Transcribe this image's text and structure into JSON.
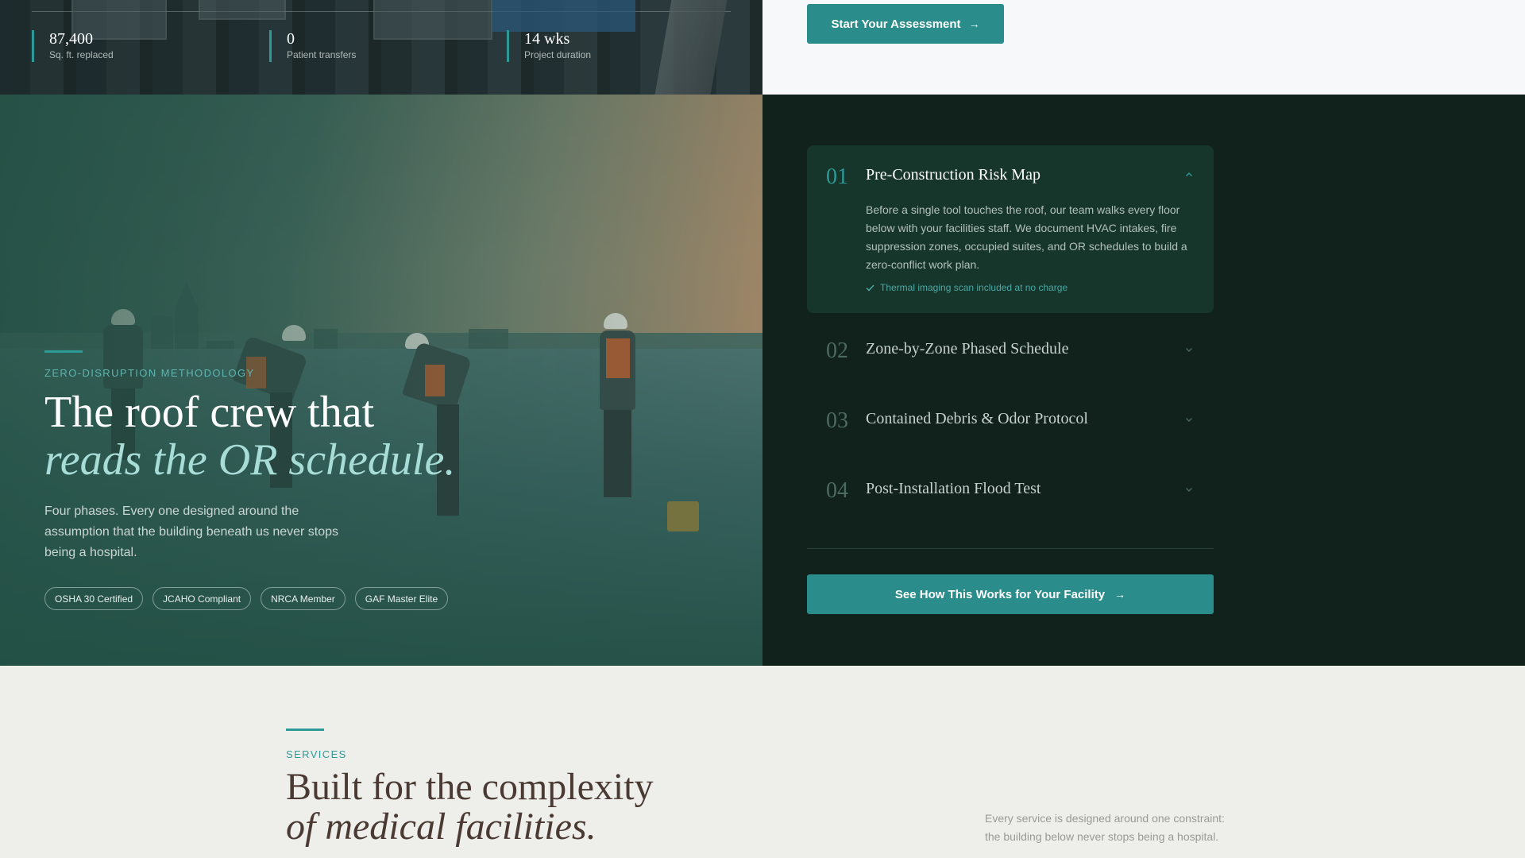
{
  "stats": [
    {
      "value": "87,400",
      "label": "Sq. ft. replaced"
    },
    {
      "value": "0",
      "label": "Patient transfers"
    },
    {
      "value": "14 wks",
      "label": "Project duration"
    }
  ],
  "cta_top": {
    "label": "Start Your Assessment"
  },
  "hero": {
    "eyebrow": "ZERO-DISRUPTION METHODOLOGY",
    "title": "The roof crew that",
    "title_em": "reads the OR schedule.",
    "subtitle": "Four phases. Every one designed around the assumption that the building beneath us never stops being a hospital.",
    "badges": [
      "OSHA 30 Certified",
      "JCAHO Compliant",
      "NRCA Member",
      "GAF Master Elite"
    ]
  },
  "steps": [
    {
      "num": "01",
      "title": "Pre-Construction Risk Map",
      "body": "Before a single tool touches the roof, our team walks every floor below with your facilities staff. We document HVAC intakes, fire suppression zones, occupied suites, and OR schedules to build a zero-conflict work plan.",
      "note": "Thermal imaging scan included at no charge",
      "expanded": true
    },
    {
      "num": "02",
      "title": "Zone-by-Zone Phased Schedule",
      "expanded": false
    },
    {
      "num": "03",
      "title": "Contained Debris & Odor Protocol",
      "expanded": false
    },
    {
      "num": "04",
      "title": "Post-Installation Flood Test",
      "expanded": false
    }
  ],
  "cta_steps": {
    "label": "See How This Works for Your Facility"
  },
  "services": {
    "eyebrow": "SERVICES",
    "title": "Built for the complexity",
    "title_em": "of medical facilities.",
    "description": "Every service is designed around one constraint: the building below never stops being a hospital."
  },
  "icons": {
    "arrow": "arrow-right-icon",
    "check": "check-icon",
    "chevron_up": "chevron-up-icon",
    "chevron_down": "chevron-down-icon"
  },
  "colors": {
    "accent": "#2a8c8b",
    "dark_panel": "#10221b",
    "open_card": "#16352b",
    "services_bg": "#eeefeb",
    "services_title": "#4a3a33"
  }
}
